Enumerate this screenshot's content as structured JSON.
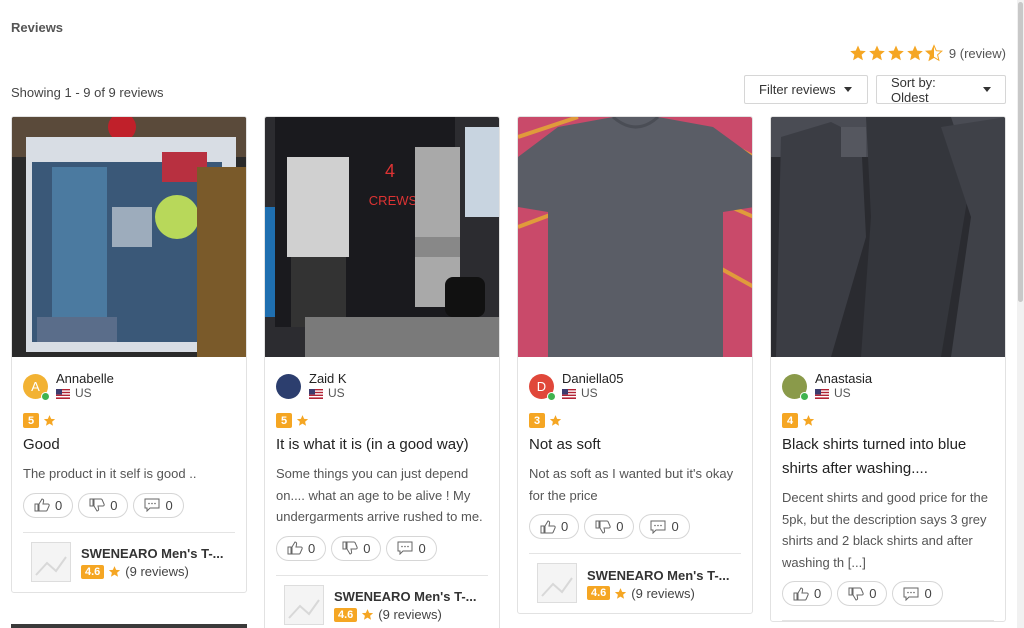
{
  "page": {
    "title": "Reviews",
    "summary_count": "9 (review)",
    "average_rating": 4.5,
    "showing": "Showing 1 - 9 of 9 reviews",
    "filter_label": "Filter reviews",
    "sort_label": "Sort by: Oldest"
  },
  "colors": {
    "star": "#f5a623",
    "accent_green": "#3fb34f"
  },
  "cards": [
    {
      "name": "Annabelle",
      "country": "US",
      "avatar_letter": "A",
      "avatar_color": "#f2b233",
      "rating": "5",
      "title": "Good",
      "text": "The product in it self is good ..",
      "likes": "0",
      "dislikes": "0",
      "comments": "0",
      "product": "SWENEARO Men's T-...",
      "product_rating": "4.6",
      "product_reviews": "(9 reviews)"
    },
    {
      "name": "Zaid K",
      "country": "US",
      "avatar_letter": "",
      "avatar_color": "#2c3e6e",
      "rating": "5",
      "title": "It is what it is (in a good way)",
      "text": "Some things you can just depend on.... what an age to be alive ! My undergarments arrive rushed to me.",
      "likes": "0",
      "dislikes": "0",
      "comments": "0",
      "product": "SWENEARO Men's T-...",
      "product_rating": "4.6",
      "product_reviews": "(9 reviews)"
    },
    {
      "name": "Daniella05",
      "country": "US",
      "avatar_letter": "D",
      "avatar_color": "#e0473a",
      "rating": "3",
      "title": "Not as soft",
      "text": "Not as soft as I wanted but it's okay for the price",
      "likes": "0",
      "dislikes": "0",
      "comments": "0",
      "product": "SWENEARO Men's T-...",
      "product_rating": "4.6",
      "product_reviews": "(9 reviews)"
    },
    {
      "name": "Anastasia",
      "country": "US",
      "avatar_letter": "",
      "avatar_color": "#8a9a4a",
      "rating": "4",
      "title": "Black shirts turned into blue shirts after washing....",
      "text": "Decent shirts and good price for the 5pk, but the description says 3 grey shirts and 2 black shirts and after washing th [...]",
      "likes": "0",
      "dislikes": "0",
      "comments": "0"
    }
  ]
}
